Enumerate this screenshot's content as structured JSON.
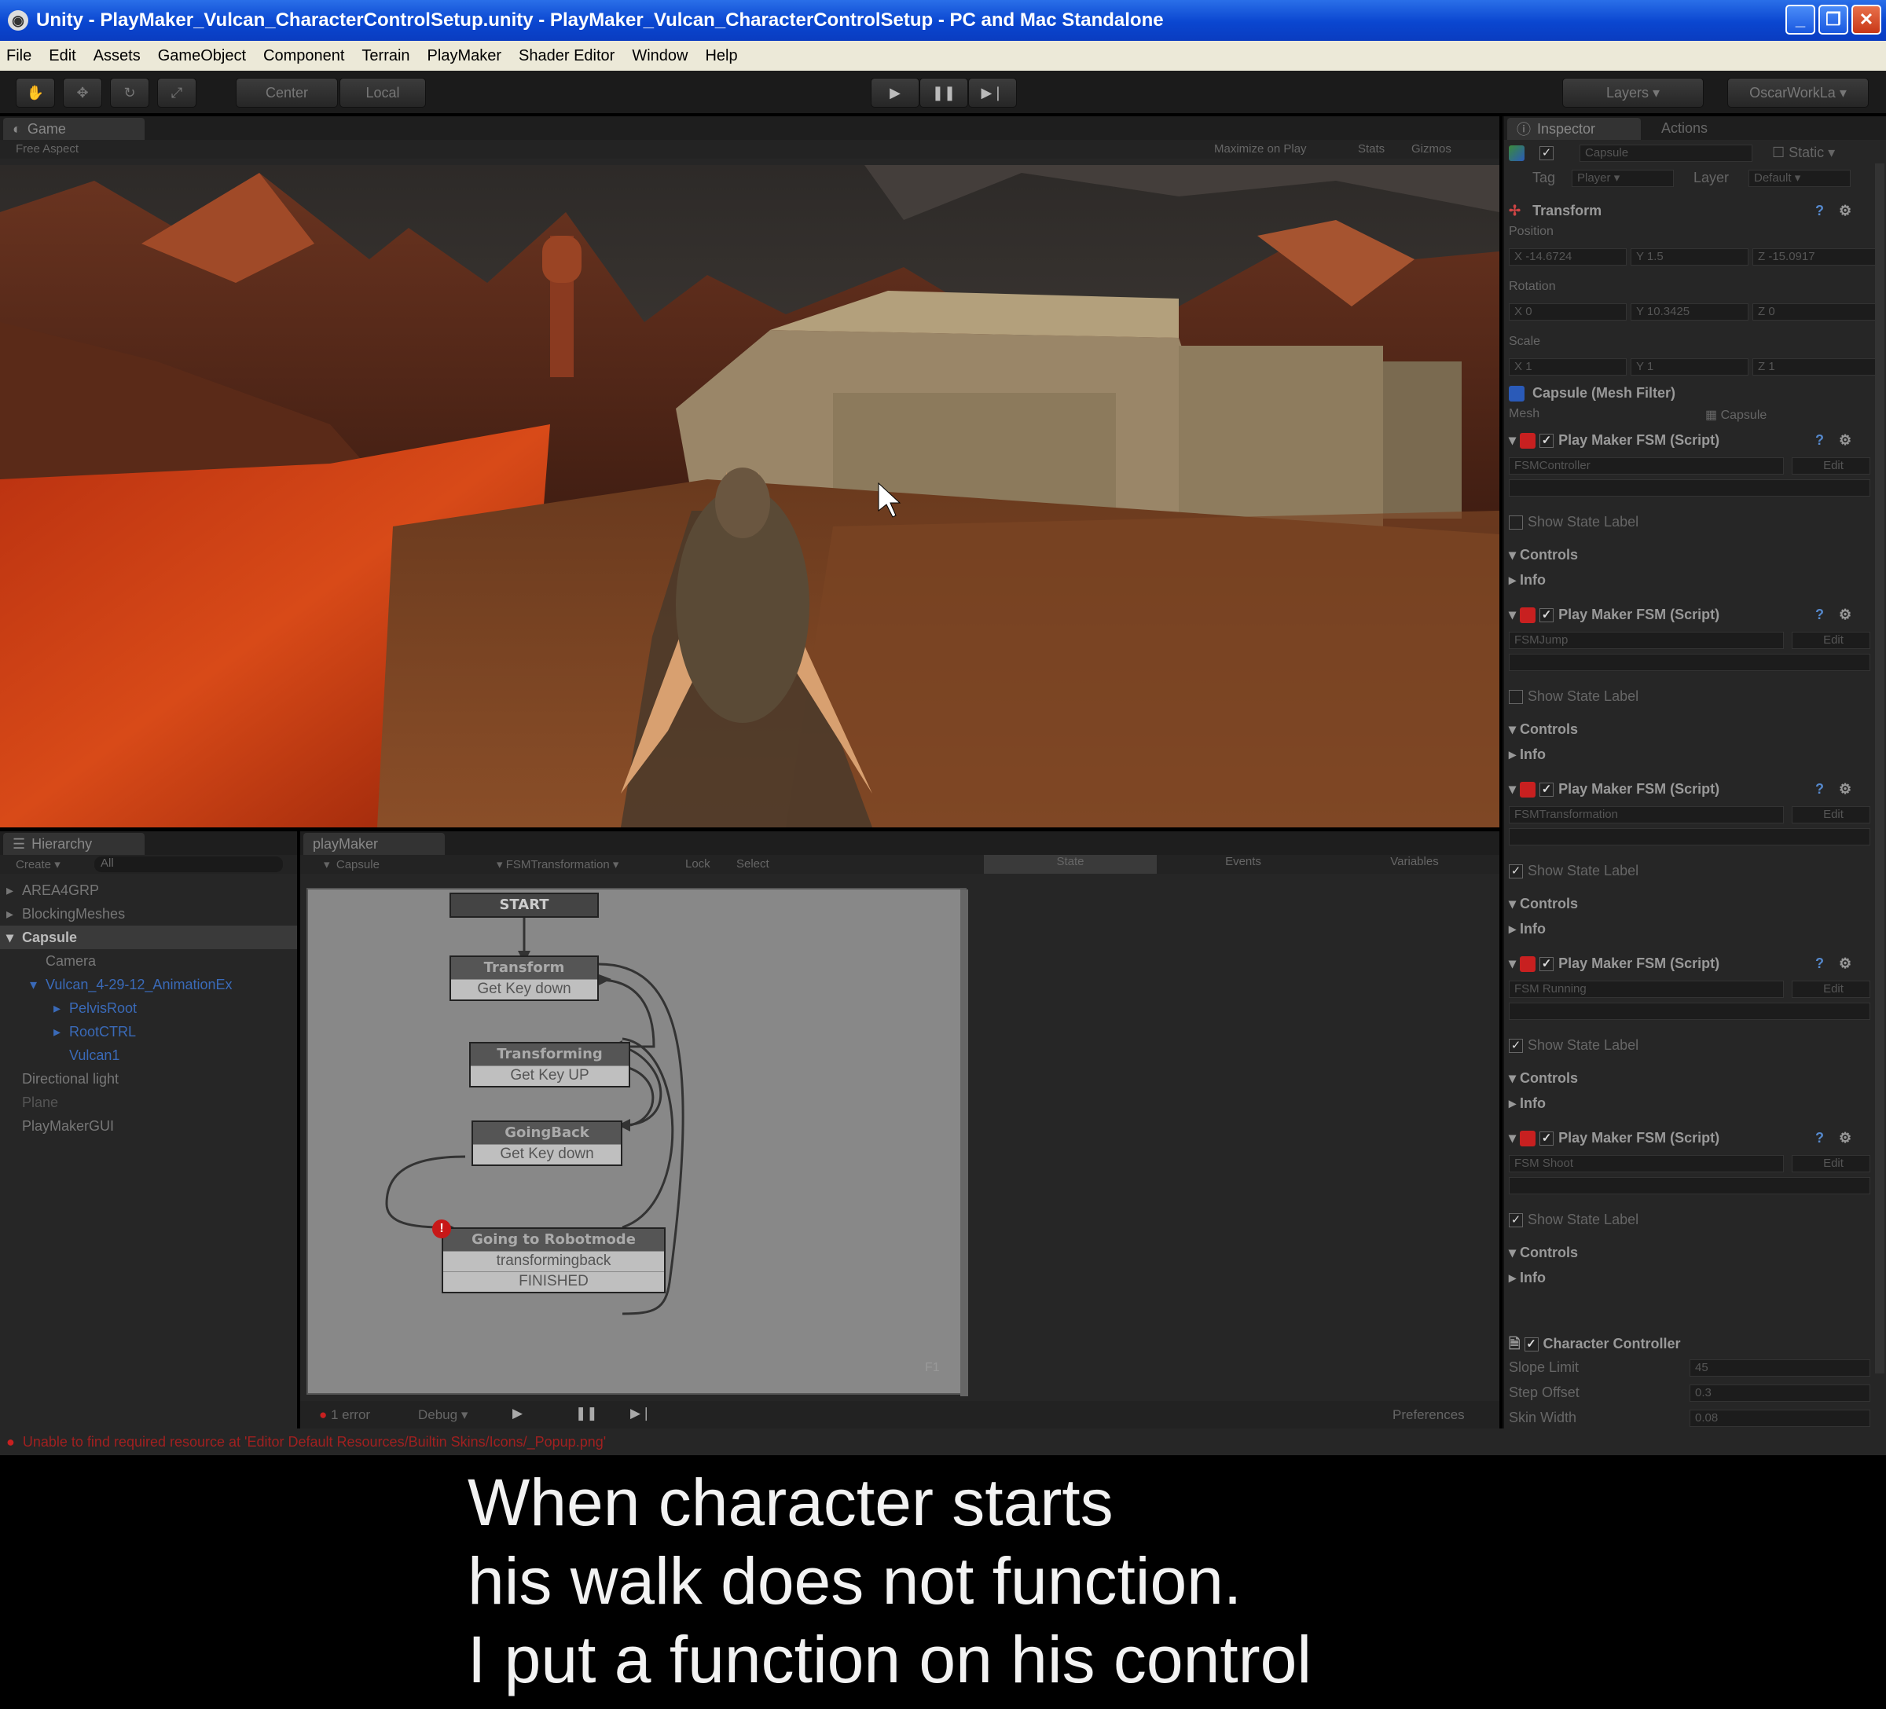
{
  "window": {
    "title": "Unity - PlayMaker_Vulcan_CharacterControlSetup.unity - PlayMaker_Vulcan_CharacterControlSetup - PC and Mac Standalone",
    "buttons": [
      "_",
      "❐",
      "✕"
    ]
  },
  "menu": [
    "File",
    "Edit",
    "Assets",
    "GameObject",
    "Component",
    "Terrain",
    "PlayMaker",
    "Shader Editor",
    "Window",
    "Help"
  ],
  "toolbar": {
    "pivot": "Center",
    "space": "Local",
    "layers": "Layers",
    "layout": "OscarWorkLa"
  },
  "game": {
    "tab": "Game",
    "aspect": "Free Aspect",
    "options": [
      "Maximize on Play",
      "Stats",
      "Gizmos"
    ]
  },
  "hierarchy": {
    "tab": "Hierarchy",
    "create": "Create",
    "search": "All",
    "items": [
      {
        "label": "AREA4GRP",
        "indent": 0,
        "arrow": "▸"
      },
      {
        "label": "BlockingMeshes",
        "indent": 0,
        "arrow": "▸"
      },
      {
        "label": "Capsule",
        "indent": 0,
        "arrow": "▾"
      },
      {
        "label": "Camera",
        "indent": 1,
        "arrow": ""
      },
      {
        "label": "Vulcan_4-29-12_AnimationEx",
        "indent": 1,
        "arrow": "▾"
      },
      {
        "label": "PelvisRoot",
        "indent": 2,
        "arrow": "▸"
      },
      {
        "label": "RootCTRL",
        "indent": 2,
        "arrow": "▸"
      },
      {
        "label": "Vulcan1",
        "indent": 2,
        "arrow": ""
      },
      {
        "label": "Directional light",
        "indent": 0,
        "arrow": ""
      },
      {
        "label": "Plane",
        "indent": 0,
        "arrow": ""
      },
      {
        "label": "PlayMakerGUI",
        "indent": 0,
        "arrow": ""
      }
    ]
  },
  "playmaker": {
    "tab": "playMaker",
    "gameobject": "Capsule",
    "fsm": "FSMTransformation",
    "lock": "Lock",
    "select": "Select",
    "tabs": [
      "State",
      "Events",
      "Variables"
    ],
    "start_label": "START",
    "states": [
      {
        "name": "Transform",
        "events": [
          "Get Key down"
        ]
      },
      {
        "name": "Transforming",
        "events": [
          "Get Key UP"
        ]
      },
      {
        "name": "GoingBack",
        "events": [
          "Get Key down"
        ]
      },
      {
        "name": "Going to Robotmode",
        "events": [
          "transformingback",
          "FINISHED"
        ]
      }
    ],
    "graph_label": "F1",
    "bottom": {
      "errors": "1 error",
      "debug": "Debug",
      "preferences": "Preferences"
    }
  },
  "inspector": {
    "tabs": [
      "Inspector",
      "Actions"
    ],
    "object_name": "Capsule",
    "static_label": "Static",
    "tag_label": "Tag",
    "tag": "Player",
    "layer_label": "Layer",
    "layer": "Default",
    "transform": {
      "title": "Transform",
      "position_label": "Position",
      "position": {
        "x": "-14.6724",
        "y": "1.5",
        "z": "-15.0917"
      },
      "rotation_label": "Rotation",
      "rotation": {
        "x": "0",
        "y": "10.3425",
        "z": "0"
      },
      "scale_label": "Scale",
      "scale": {
        "x": "1",
        "y": "1",
        "z": "1"
      }
    },
    "mesh_filter": {
      "title": "Capsule (Mesh Filter)",
      "mesh_label": "Mesh",
      "mesh": "Capsule"
    },
    "fsms": [
      {
        "title": "Play Maker FSM (Script)",
        "name": "FSMController",
        "show_state_label": "Show State Label",
        "controls": "Controls",
        "info": "Info",
        "checked": false
      },
      {
        "title": "Play Maker FSM (Script)",
        "name": "FSMJump",
        "show_state_label": "Show State Label",
        "controls": "Controls",
        "info": "Info",
        "checked": false
      },
      {
        "title": "Play Maker FSM (Script)",
        "name": "FSMTransformation",
        "show_state_label": "Show State Label",
        "controls": "Controls",
        "info": "Info",
        "checked": true
      },
      {
        "title": "Play Maker FSM (Script)",
        "name": "FSM Running",
        "show_state_label": "Show State Label",
        "controls": "Controls",
        "info": "Info",
        "checked": true
      },
      {
        "title": "Play Maker FSM (Script)",
        "name": "FSM Shoot",
        "show_state_label": "Show State Label",
        "controls": "Controls",
        "info": "Info",
        "checked": true
      }
    ],
    "edit_label": "Edit",
    "character_controller": {
      "title": "Character Controller",
      "fields": [
        {
          "label": "Slope Limit",
          "value": "45"
        },
        {
          "label": "Step Offset",
          "value": "0.3"
        },
        {
          "label": "Skin Width",
          "value": "0.08"
        }
      ]
    }
  },
  "console_error": "Unable to find required resource at 'Editor Default Resources/Builtin Skins/Icons/_Popup.png'",
  "caption": [
    "When character starts",
    "his walk does not function.",
    "I put a function on his control"
  ]
}
